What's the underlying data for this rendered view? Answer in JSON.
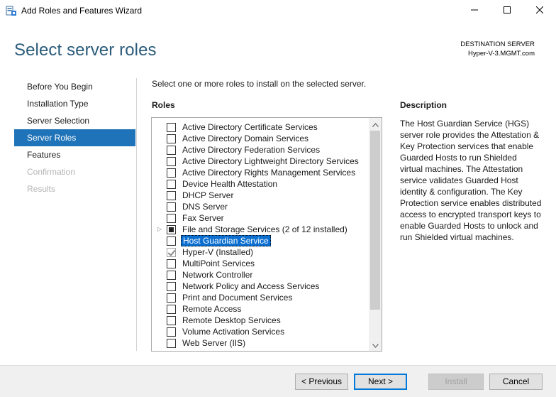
{
  "window": {
    "title": "Add Roles and Features Wizard",
    "icon": "server-manager-icon"
  },
  "header": {
    "page_title": "Select server roles",
    "destination_label": "DESTINATION SERVER",
    "destination_value": "Hyper-V-3.MGMT.com"
  },
  "nav": {
    "items": [
      {
        "label": "Before You Begin",
        "state": "normal"
      },
      {
        "label": "Installation Type",
        "state": "normal"
      },
      {
        "label": "Server Selection",
        "state": "normal"
      },
      {
        "label": "Server Roles",
        "state": "active"
      },
      {
        "label": "Features",
        "state": "normal"
      },
      {
        "label": "Confirmation",
        "state": "disabled"
      },
      {
        "label": "Results",
        "state": "disabled"
      }
    ]
  },
  "main": {
    "instruction": "Select one or more roles to install on the selected server.",
    "roles_heading": "Roles",
    "description_heading": "Description",
    "description_text": "The Host Guardian Service (HGS) server role provides the Attestation & Key Protection services that enable Guarded Hosts to run Shielded virtual machines. The Attestation service validates Guarded Host identity & configuration. The Key Protection service enables distributed access to encrypted transport keys to enable Guarded Hosts to unlock and run Shielded virtual machines.",
    "roles": [
      {
        "label": "Active Directory Certificate Services",
        "check": "unchecked",
        "selected": false,
        "expandable": false
      },
      {
        "label": "Active Directory Domain Services",
        "check": "unchecked",
        "selected": false,
        "expandable": false
      },
      {
        "label": "Active Directory Federation Services",
        "check": "unchecked",
        "selected": false,
        "expandable": false
      },
      {
        "label": "Active Directory Lightweight Directory Services",
        "check": "unchecked",
        "selected": false,
        "expandable": false
      },
      {
        "label": "Active Directory Rights Management Services",
        "check": "unchecked",
        "selected": false,
        "expandable": false
      },
      {
        "label": "Device Health Attestation",
        "check": "unchecked",
        "selected": false,
        "expandable": false
      },
      {
        "label": "DHCP Server",
        "check": "unchecked",
        "selected": false,
        "expandable": false
      },
      {
        "label": "DNS Server",
        "check": "unchecked",
        "selected": false,
        "expandable": false
      },
      {
        "label": "Fax Server",
        "check": "unchecked",
        "selected": false,
        "expandable": false
      },
      {
        "label": "File and Storage Services (2 of 12 installed)",
        "check": "partial",
        "selected": false,
        "expandable": true
      },
      {
        "label": "Host Guardian Service",
        "check": "unchecked",
        "selected": true,
        "expandable": false
      },
      {
        "label": "Hyper-V (Installed)",
        "check": "checked",
        "selected": false,
        "expandable": false
      },
      {
        "label": "MultiPoint Services",
        "check": "unchecked",
        "selected": false,
        "expandable": false
      },
      {
        "label": "Network Controller",
        "check": "unchecked",
        "selected": false,
        "expandable": false
      },
      {
        "label": "Network Policy and Access Services",
        "check": "unchecked",
        "selected": false,
        "expandable": false
      },
      {
        "label": "Print and Document Services",
        "check": "unchecked",
        "selected": false,
        "expandable": false
      },
      {
        "label": "Remote Access",
        "check": "unchecked",
        "selected": false,
        "expandable": false
      },
      {
        "label": "Remote Desktop Services",
        "check": "unchecked",
        "selected": false,
        "expandable": false
      },
      {
        "label": "Volume Activation Services",
        "check": "unchecked",
        "selected": false,
        "expandable": false
      },
      {
        "label": "Web Server (IIS)",
        "check": "unchecked",
        "selected": false,
        "expandable": false
      }
    ]
  },
  "footer": {
    "previous_label": "< Previous",
    "next_label": "Next >",
    "install_label": "Install",
    "cancel_label": "Cancel"
  }
}
